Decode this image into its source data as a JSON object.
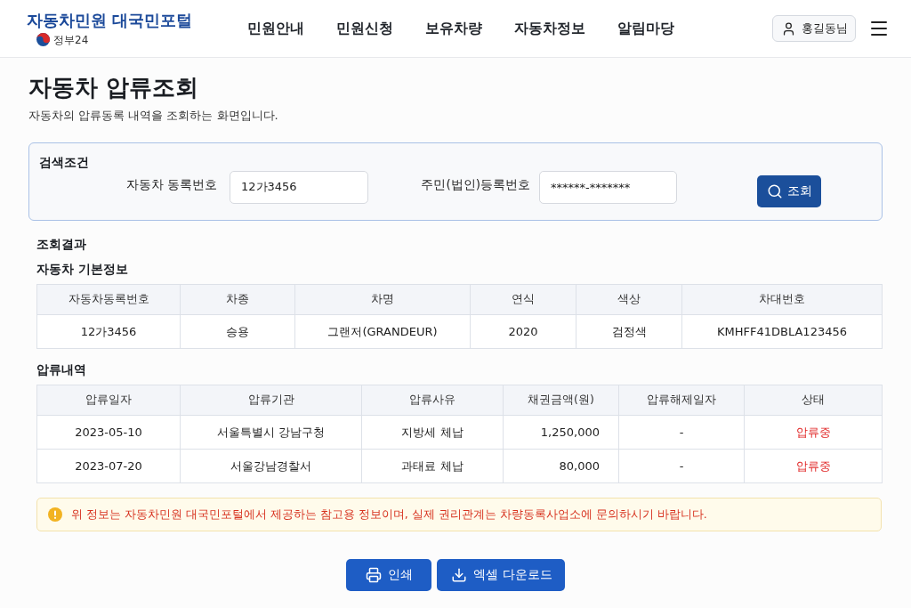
{
  "header": {
    "logo_title": "자동차민원 대국민포털",
    "logo_subtitle": "정부24",
    "nav": [
      "민원안내",
      "민원신청",
      "보유차량",
      "자동차정보",
      "알림마당"
    ],
    "user": "홍길동님"
  },
  "page": {
    "title": "자동차 압류조회",
    "description": "자동차의 압류동록 내역을 조회하는 화면입니다."
  },
  "search": {
    "title": "검색조건",
    "fields": [
      {
        "label": "자동차 동록번호",
        "value": "12가3456"
      },
      {
        "label": "주민(법인)등록번호",
        "value": "******-*******"
      }
    ],
    "button": "조회"
  },
  "results": {
    "title": "조회결과",
    "tables": [
      {
        "title": "자동차 기본정보",
        "columns": [
          {
            "label": "자동차동록번호",
            "kind": "text"
          },
          {
            "label": "차종",
            "kind": "text"
          },
          {
            "label": "차명",
            "kind": "text"
          },
          {
            "label": "연식",
            "kind": "text"
          },
          {
            "label": "색상",
            "kind": "text"
          },
          {
            "label": "차대번호",
            "kind": "text"
          }
        ],
        "rows": [
          [
            "12가3456",
            "승용",
            "그랜저(GRANDEUR)",
            "2020",
            "검정색",
            "KMHFF41DBLA123456"
          ]
        ]
      },
      {
        "title": "압류내역",
        "columns": [
          {
            "label": "압류일자",
            "kind": "text"
          },
          {
            "label": "압류기관",
            "kind": "text"
          },
          {
            "label": "압류사유",
            "kind": "text"
          },
          {
            "label": "채권금액(원)",
            "kind": "amount"
          },
          {
            "label": "압류해제일자",
            "kind": "text"
          },
          {
            "label": "상태",
            "kind": "status"
          }
        ],
        "rows": [
          [
            "2023-05-10",
            "서울특별시 강남구청",
            "지방세 체납",
            "1,250,000",
            "-",
            "압류중"
          ],
          [
            "2023-07-20",
            "서울강남경찰서",
            "과태료 체납",
            "80,000",
            "-",
            "압류중"
          ]
        ]
      }
    ]
  },
  "notice": "위 정보는 자동차민원 대국민포털에서 제공하는 참고용 정보이며, 실제 권리관계는 차량동록사업소에 문의하시기 바랍니다.",
  "actions": [
    {
      "label": "인쇄",
      "kind": "print"
    },
    {
      "label": "엑셀 다운로드",
      "kind": "download"
    }
  ]
}
